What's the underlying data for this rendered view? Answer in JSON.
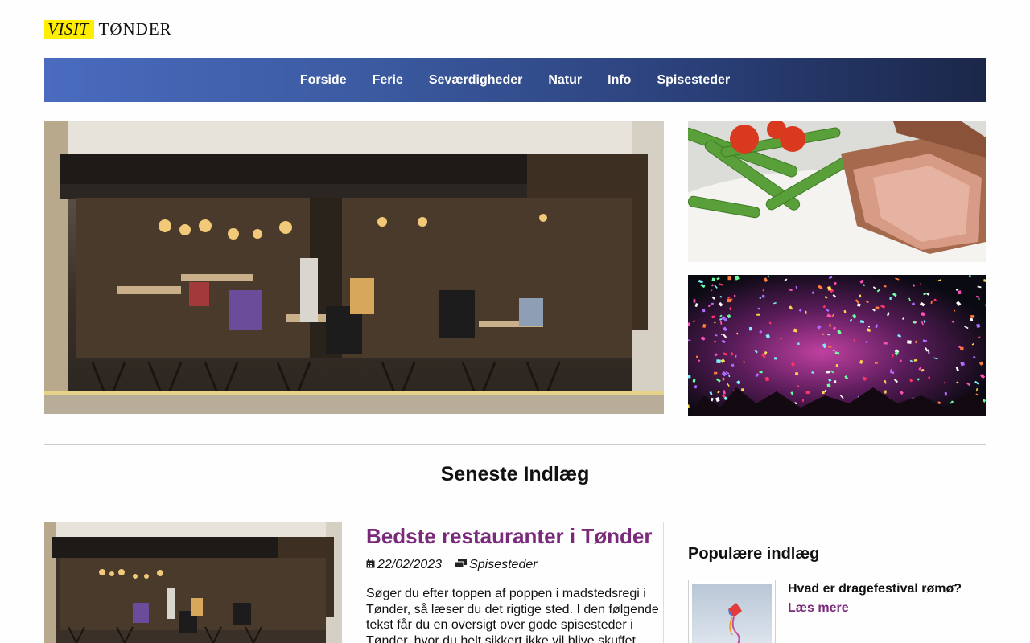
{
  "logo": {
    "visit": "VISIT",
    "town": "TØNDER"
  },
  "nav": [
    {
      "label": "Forside"
    },
    {
      "label": "Ferie"
    },
    {
      "label": "Seværdigheder"
    },
    {
      "label": "Natur"
    },
    {
      "label": "Info"
    },
    {
      "label": "Spisesteder"
    }
  ],
  "latest": {
    "heading": "Seneste Indlæg",
    "post": {
      "title": "Bedste restauranter i Tønder",
      "date": "22/02/2023",
      "category": "Spisesteder",
      "excerpt": "Søger du efter toppen af poppen i madstedsregi i Tønder, så læser du det rigtige sted. I den følgende tekst får du en oversigt over gode spisesteder i Tønder, hvor du helt sikkert ikke vil blive skuffet."
    }
  },
  "popular": {
    "heading": "Populære indlæg",
    "items": [
      {
        "title": "Hvad er dragefestival rømø?",
        "link": "Læs mere"
      }
    ]
  },
  "colors": {
    "accent": "#7a2a7a",
    "logo_yellow": "#ffee00",
    "nav_start": "#4a6bbf",
    "nav_end": "#1b2749"
  },
  "icons": {
    "date": "calendar-icon",
    "category": "folder-icon"
  }
}
